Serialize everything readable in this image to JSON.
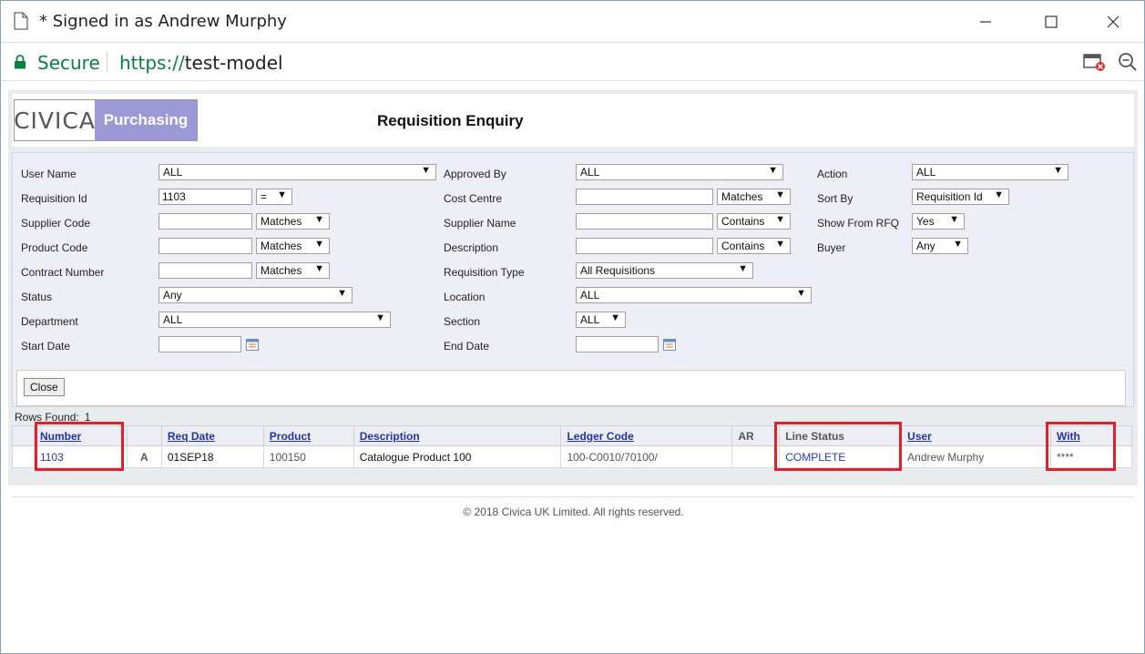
{
  "window": {
    "title": "* Signed in as Andrew Murphy",
    "minimize": "—",
    "maximize": "☐",
    "close": "✕"
  },
  "address": {
    "secure_label": "Secure",
    "url_scheme": "https://",
    "url_host": "test-model"
  },
  "app": {
    "logo_left": "CIVICA",
    "logo_right": "Purchasing",
    "page_title": "Requisition Enquiry"
  },
  "filters": {
    "user_name": {
      "label": "User Name",
      "value": "ALL"
    },
    "approved_by": {
      "label": "Approved By",
      "value": "ALL"
    },
    "action": {
      "label": "Action",
      "value": "ALL"
    },
    "requisition_id": {
      "label": "Requisition Id",
      "value": "1103",
      "op": "="
    },
    "cost_centre": {
      "label": "Cost Centre",
      "value": "",
      "op": "Matches"
    },
    "sort_by": {
      "label": "Sort By",
      "value": "Requisition Id"
    },
    "supplier_code": {
      "label": "Supplier Code",
      "value": "",
      "op": "Matches"
    },
    "supplier_name": {
      "label": "Supplier Name",
      "value": "",
      "op": "Contains"
    },
    "show_from_rfq": {
      "label": "Show From RFQ",
      "value": "Yes"
    },
    "product_code": {
      "label": "Product Code",
      "value": "",
      "op": "Matches"
    },
    "description": {
      "label": "Description",
      "value": "",
      "op": "Contains"
    },
    "buyer": {
      "label": "Buyer",
      "value": "Any"
    },
    "contract_number": {
      "label": "Contract Number",
      "value": "",
      "op": "Matches"
    },
    "requisition_type": {
      "label": "Requisition Type",
      "value": "All Requisitions"
    },
    "status": {
      "label": "Status",
      "value": "Any"
    },
    "location": {
      "label": "Location",
      "value": "ALL"
    },
    "department": {
      "label": "Department",
      "value": "ALL"
    },
    "section": {
      "label": "Section",
      "value": "ALL"
    },
    "start_date": {
      "label": "Start Date",
      "value": ""
    },
    "end_date": {
      "label": "End Date",
      "value": ""
    }
  },
  "close_button": "Close",
  "results": {
    "rows_found_label": "Rows Found:",
    "rows_found_count": "1",
    "columns": [
      "Number",
      "",
      "Req Date",
      "Product",
      "Description",
      "Ledger Code",
      "AR",
      "Line Status",
      "User",
      "With"
    ],
    "rows": [
      {
        "number": "1103",
        "flag": "A",
        "req_date": "01SEP18",
        "product": "100150",
        "description": "Catalogue Product 100",
        "ledger_code": "100-C0010/70100/",
        "ar": "",
        "line_status": "COMPLETE",
        "user": "Andrew Murphy",
        "with": "****"
      }
    ]
  },
  "footer": {
    "copyright": "© 2018 Civica UK Limited. All rights reserved."
  },
  "colors": {
    "highlight": "#e0202a",
    "brand_purple": "#9b98d6",
    "link": "#2233aa",
    "secure_green": "#0b8043"
  }
}
